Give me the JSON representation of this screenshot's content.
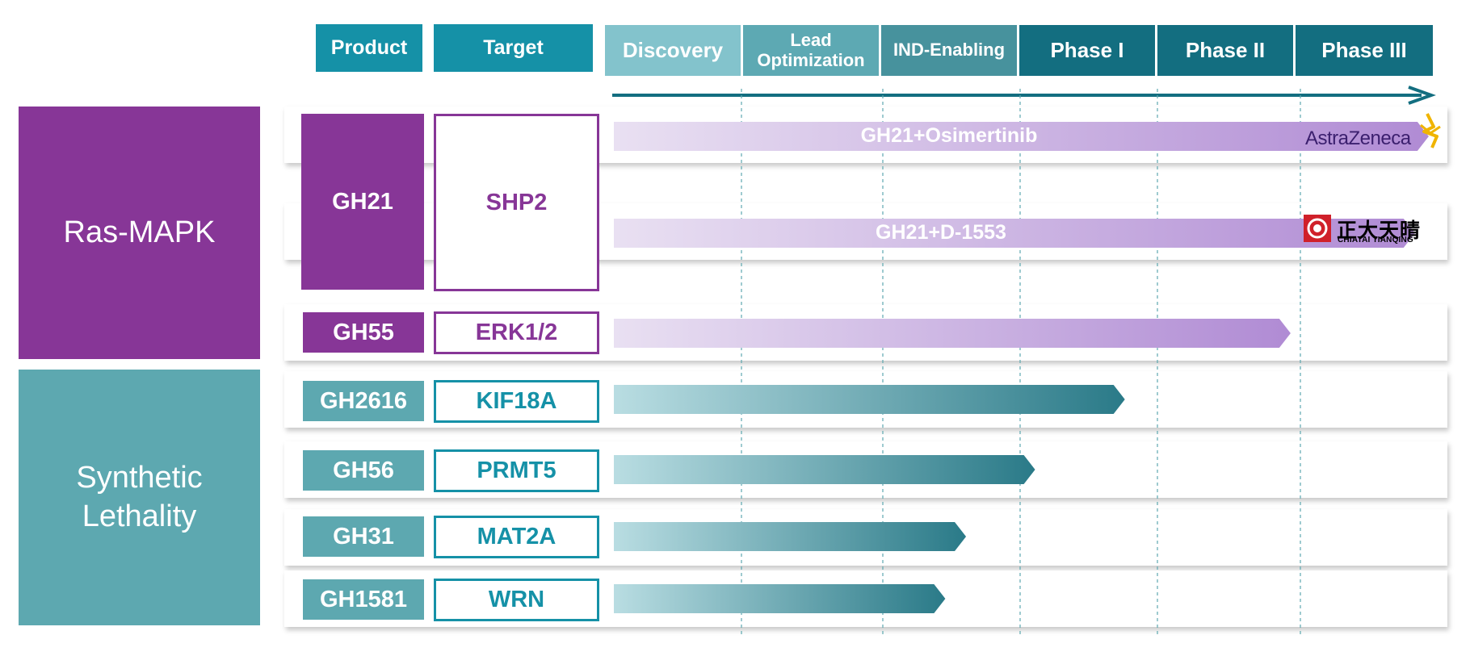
{
  "headers": {
    "product": "Product",
    "target": "Target",
    "phases": [
      "Discovery",
      "Lead Optimization",
      "IND-Enabling",
      "Phase I",
      "Phase II",
      "Phase III"
    ]
  },
  "categories": [
    {
      "label": "Ras-MAPK",
      "color": "#873697"
    },
    {
      "label": "Synthetic Lethality",
      "color": "#5da8b0"
    }
  ],
  "programs": [
    {
      "product": "GH21",
      "target": "SHP2",
      "category": "Ras-MAPK",
      "combos": [
        {
          "label": "GH21+Osimertinib",
          "progress_phase": 5.9,
          "partner": "AstraZeneca"
        },
        {
          "label": "GH21+D-1553",
          "progress_phase": 5.8,
          "partner_cn": "正大天晴",
          "partner_en": "CHIATAI TIANQING"
        }
      ]
    },
    {
      "product": "GH55",
      "target": "ERK1/2",
      "category": "Ras-MAPK",
      "progress_phase": 4.9
    },
    {
      "product": "GH2616",
      "target": "KIF18A",
      "category": "Synthetic Lethality",
      "progress_phase": 3.7
    },
    {
      "product": "GH56",
      "target": "PRMT5",
      "category": "Synthetic Lethality",
      "progress_phase": 3.05
    },
    {
      "product": "GH31",
      "target": "MAT2A",
      "category": "Synthetic Lethality",
      "progress_phase": 2.55
    },
    {
      "product": "GH1581",
      "target": "WRN",
      "category": "Synthetic Lethality",
      "progress_phase": 2.4
    }
  ],
  "colors": {
    "ras": "#873697",
    "syn": "#5da8b0",
    "header": "#1591a7",
    "phase_dark": "#136e80"
  }
}
